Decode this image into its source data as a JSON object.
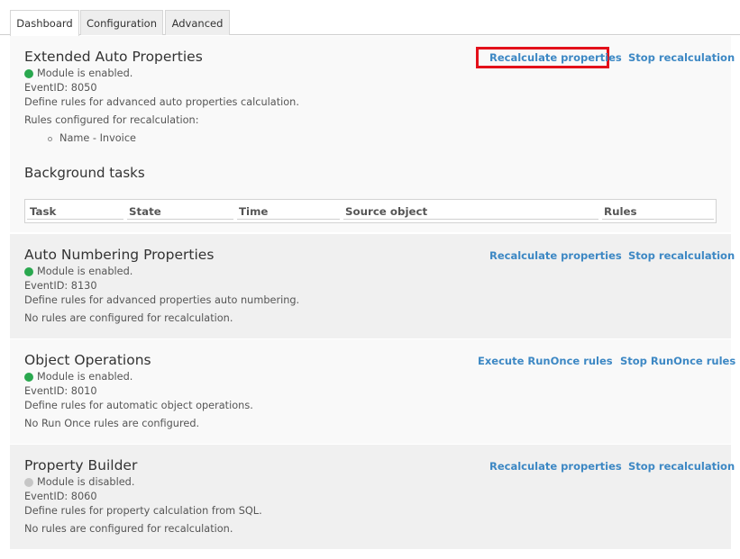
{
  "tabs": [
    {
      "label": "Dashboard",
      "active": true
    },
    {
      "label": "Configuration",
      "active": false
    },
    {
      "label": "Advanced",
      "active": false
    }
  ],
  "modules": [
    {
      "title": "Extended Auto Properties",
      "status": "Module is enabled.",
      "status_color": "#2aa84f",
      "event_id": "EventID: 8050",
      "description": "Define rules for advanced auto properties calculation.",
      "rules_text": "Rules configured for recalculation:",
      "rules": [
        "Name - Invoice"
      ],
      "action_primary": "Recalculate properties",
      "action_secondary": "Stop recalculation"
    },
    {
      "title": "Auto Numbering Properties",
      "status": "Module is enabled.",
      "status_color": "#2aa84f",
      "event_id": "EventID: 8130",
      "description": "Define rules for advanced properties auto numbering.",
      "rules_text": "No rules are configured for recalculation.",
      "action_primary": "Recalculate properties",
      "action_secondary": "Stop recalculation"
    },
    {
      "title": "Object Operations",
      "status": "Module is enabled.",
      "status_color": "#2aa84f",
      "event_id": "EventID: 8010",
      "description": "Define rules for automatic object operations.",
      "rules_text": "No Run Once rules are configured.",
      "action_primary": "Execute RunOnce rules",
      "action_secondary": "Stop RunOnce rules"
    },
    {
      "title": "Property Builder",
      "status": "Module is disabled.",
      "status_color": "#c6c6c6",
      "event_id": "EventID: 8060",
      "description": "Define rules for property calculation from SQL.",
      "rules_text": "No rules are configured for recalculation.",
      "action_primary": "Recalculate properties",
      "action_secondary": "Stop recalculation"
    }
  ],
  "background_tasks": {
    "title": "Background tasks",
    "columns": [
      "Task",
      "State",
      "Time",
      "Source object",
      "Rules"
    ]
  },
  "colors": {
    "link": "#3d88c4",
    "highlight": "#e3101a",
    "enabled": "#2aa84f",
    "disabled": "#c6c6c6"
  }
}
